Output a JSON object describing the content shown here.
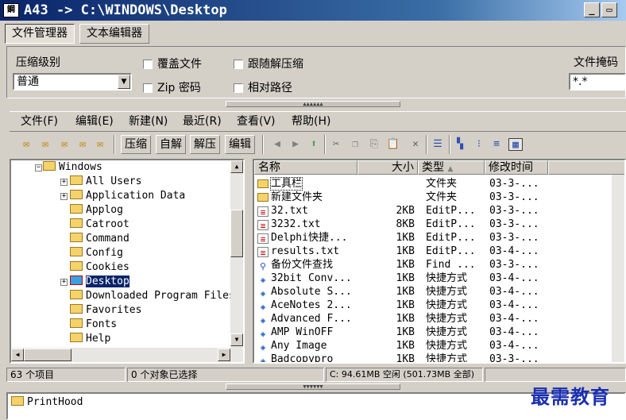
{
  "window": {
    "title": "A43  -> C:\\WINDOWS\\Desktop",
    "app_icon_text": "鋼"
  },
  "top_tabs": [
    "文件管理器",
    "文本编辑器"
  ],
  "options": {
    "level_label": "压缩级别",
    "level_value": "普通",
    "overwrite": "覆盖文件",
    "zip_password": "Zip 密码",
    "follow_unzip": "跟随解压缩",
    "relative_path": "相对路径",
    "mask_label": "文件掩码",
    "mask_value": "*.*"
  },
  "menu": [
    "文件(F)",
    "编辑(E)",
    "新建(N)",
    "最近(R)",
    "查看(V)",
    "帮助(H)"
  ],
  "toolbar": {
    "compress": "压缩",
    "self_extract": "自解",
    "extract": "解压",
    "edit": "编辑"
  },
  "tree": {
    "root": "Windows",
    "items": [
      "All Users",
      "Application Data",
      "Applog",
      "Catroot",
      "Command",
      "Config",
      "Cookies",
      "Desktop",
      "Downloaded Program Files",
      "Favorites",
      "Fonts",
      "Help"
    ]
  },
  "list": {
    "headers": {
      "name": "名称",
      "size": "大小",
      "type": "类型",
      "date": "修改时间"
    },
    "rows": [
      {
        "name": "工具栏",
        "size": "",
        "type": "文件夹",
        "date": "03-3-...",
        "icon": "folder"
      },
      {
        "name": "新建文件夹",
        "size": "",
        "type": "文件夹",
        "date": "03-3-...",
        "icon": "folder"
      },
      {
        "name": "32.txt",
        "size": "2KB",
        "type": "EditP...",
        "date": "03-3-...",
        "icon": "txt"
      },
      {
        "name": "3232.txt",
        "size": "8KB",
        "type": "EditP...",
        "date": "03-3-...",
        "icon": "txt"
      },
      {
        "name": "Delphi快捷...",
        "size": "1KB",
        "type": "EditP...",
        "date": "03-3-...",
        "icon": "txt"
      },
      {
        "name": "results.txt",
        "size": "1KB",
        "type": "EditP...",
        "date": "03-4-...",
        "icon": "txt"
      },
      {
        "name": "备份文件查找",
        "size": "1KB",
        "type": "Find ...",
        "date": "03-3-...",
        "icon": "find"
      },
      {
        "name": "32bit Conv...",
        "size": "1KB",
        "type": "快捷方式",
        "date": "03-4-...",
        "icon": "shortcut"
      },
      {
        "name": "Absolute S...",
        "size": "1KB",
        "type": "快捷方式",
        "date": "03-4-...",
        "icon": "shortcut"
      },
      {
        "name": "AceNotes 2...",
        "size": "1KB",
        "type": "快捷方式",
        "date": "03-4-...",
        "icon": "shortcut"
      },
      {
        "name": "Advanced F...",
        "size": "1KB",
        "type": "快捷方式",
        "date": "03-4-...",
        "icon": "shortcut"
      },
      {
        "name": "AMP WinOFF",
        "size": "1KB",
        "type": "快捷方式",
        "date": "03-4-...",
        "icon": "shortcut"
      },
      {
        "name": "Any Image",
        "size": "1KB",
        "type": "快捷方式",
        "date": "03-4-...",
        "icon": "shortcut"
      },
      {
        "name": "Badcopypro",
        "size": "1KB",
        "type": "快捷方式",
        "date": "03-3-...",
        "icon": "shortcut"
      }
    ]
  },
  "status": {
    "count": "63 个项目",
    "selected": "0 个对象已选择",
    "disk": "C: 94.61MB 空闲 (501.73MB 全部)"
  },
  "bottom": {
    "item": "PrintHood"
  },
  "watermark": "最需教育"
}
